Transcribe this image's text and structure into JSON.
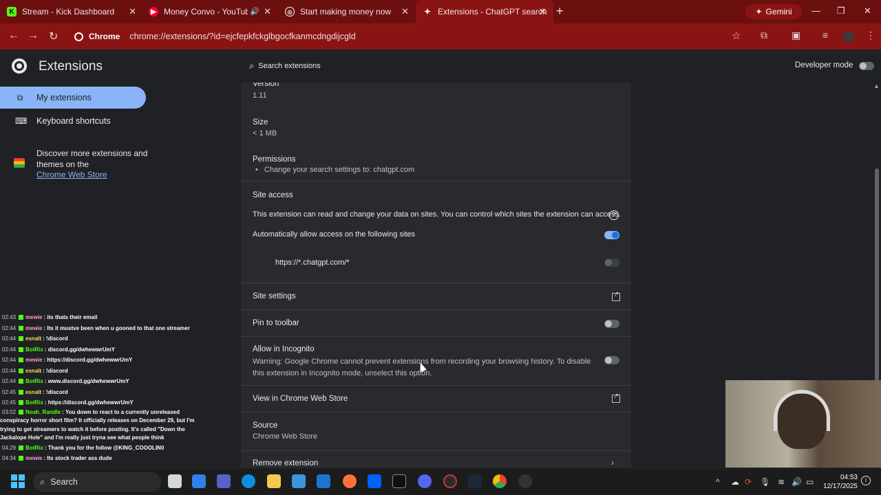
{
  "tabs": [
    {
      "label": "Stream - Kick Dashboard",
      "fav": "K",
      "favColor": "#53fc18",
      "favText": "#000"
    },
    {
      "label": "Money Convo - YouTube M",
      "fav": "▶",
      "favColor": "#ff0033",
      "favText": "#fff"
    },
    {
      "label": "Start making money now",
      "fav": "◎",
      "favColor": "#6b0f0f",
      "favText": "#fff"
    },
    {
      "label": "Extensions - ChatGPT search",
      "fav": "✦",
      "favColor": "#8a1414",
      "favText": "#fff"
    }
  ],
  "gemini_label": "Gemini",
  "omnibox": {
    "chip": "Chrome",
    "url": "chrome://extensions/?id=ejcfepkfckglbgocfkanmcdngdijcgld"
  },
  "header": {
    "title": "Extensions",
    "search_placeholder": "Search extensions",
    "dev_mode": "Developer mode"
  },
  "sidebar": {
    "my_extensions": "My extensions",
    "keyboard_shortcuts": "Keyboard shortcuts",
    "discover_prefix": "Discover more extensions and themes on the",
    "webstore_link": "Chrome Web Store"
  },
  "details": {
    "version_label": "Version",
    "version_value": "1.11",
    "size_label": "Size",
    "size_value": "< 1 MB",
    "permissions_label": "Permissions",
    "permission_item": "Change your search settings to: chatgpt.com",
    "site_access_label": "Site access",
    "site_access_desc": "This extension can read and change your data on sites. You can control which sites the extension can access.",
    "auto_allow": "Automatically allow access on the following sites",
    "site_pattern": "https://*.chatgpt.com/*",
    "site_settings": "Site settings",
    "pin_toolbar": "Pin to toolbar",
    "incognito_label": "Allow in Incognito",
    "incognito_warning": "Warning: Google Chrome cannot prevent extensions from recording your browsing history. To disable this extension in Incognito mode, unselect this option.",
    "view_store": "View in Chrome Web Store",
    "source_label": "Source",
    "source_value": "Chrome Web Store",
    "remove": "Remove extension"
  },
  "chat": [
    {
      "ts": "02:43",
      "user": "mewie",
      "color": "#ff9bd3",
      "msg": ": its thats their email"
    },
    {
      "ts": "02:44",
      "user": "mewie",
      "color": "#ff9bd3",
      "msg": ": Its it mustve been when u gooned to that one streamer"
    },
    {
      "ts": "02:44",
      "user": "esnalt",
      "color": "#ffd966",
      "msg": ": !discord"
    },
    {
      "ts": "02:44",
      "user": "BotRix",
      "color": "#53fc18",
      "msg": ": discord.gg/dwhewwrUmY"
    },
    {
      "ts": "02:44",
      "user": "mewie",
      "color": "#ff9bd3",
      "msg": ": https://discord.gg/dwhewwrUmY"
    },
    {
      "ts": "02:44",
      "user": "esnalt",
      "color": "#ffd966",
      "msg": ": !discord"
    },
    {
      "ts": "02:44",
      "user": "BotRix",
      "color": "#53fc18",
      "msg": ": www.discord.gg/dwhewwrUmY"
    },
    {
      "ts": "02:45",
      "user": "esnalt",
      "color": "#ffd966",
      "msg": ": !discord"
    },
    {
      "ts": "02:45",
      "user": "BotRix",
      "color": "#53fc18",
      "msg": ": https://discord.gg/dwhewwrUmY"
    },
    {
      "ts": "03:02",
      "user": "Noah_Randle",
      "color": "#53fc18",
      "msg": ": You down to react to a currently unreleased conspiracy horror short film? It officially releases on December 29, but I'm trying to get streamers to watch it before posting. It's called \"Down the Jackalope Hole\" and I'm really just tryna see what people think",
      "wrap": true
    },
    {
      "ts": "04:29",
      "user": "BotRix",
      "color": "#53fc18",
      "msg": ": Thank you for the follow @KING_COOOLIN0"
    },
    {
      "ts": "04:34",
      "user": "mewie",
      "color": "#ff9bd3",
      "msg": ": Its stock trader ass dude"
    }
  ],
  "taskbar": {
    "search": "Search",
    "time": "04:53",
    "date": "12/17/2025"
  },
  "colors": {
    "tab_strip": "#6b0f0f",
    "toolbar": "#8a1414",
    "accent": "#8ab4f8",
    "panel": "#292a2d"
  }
}
